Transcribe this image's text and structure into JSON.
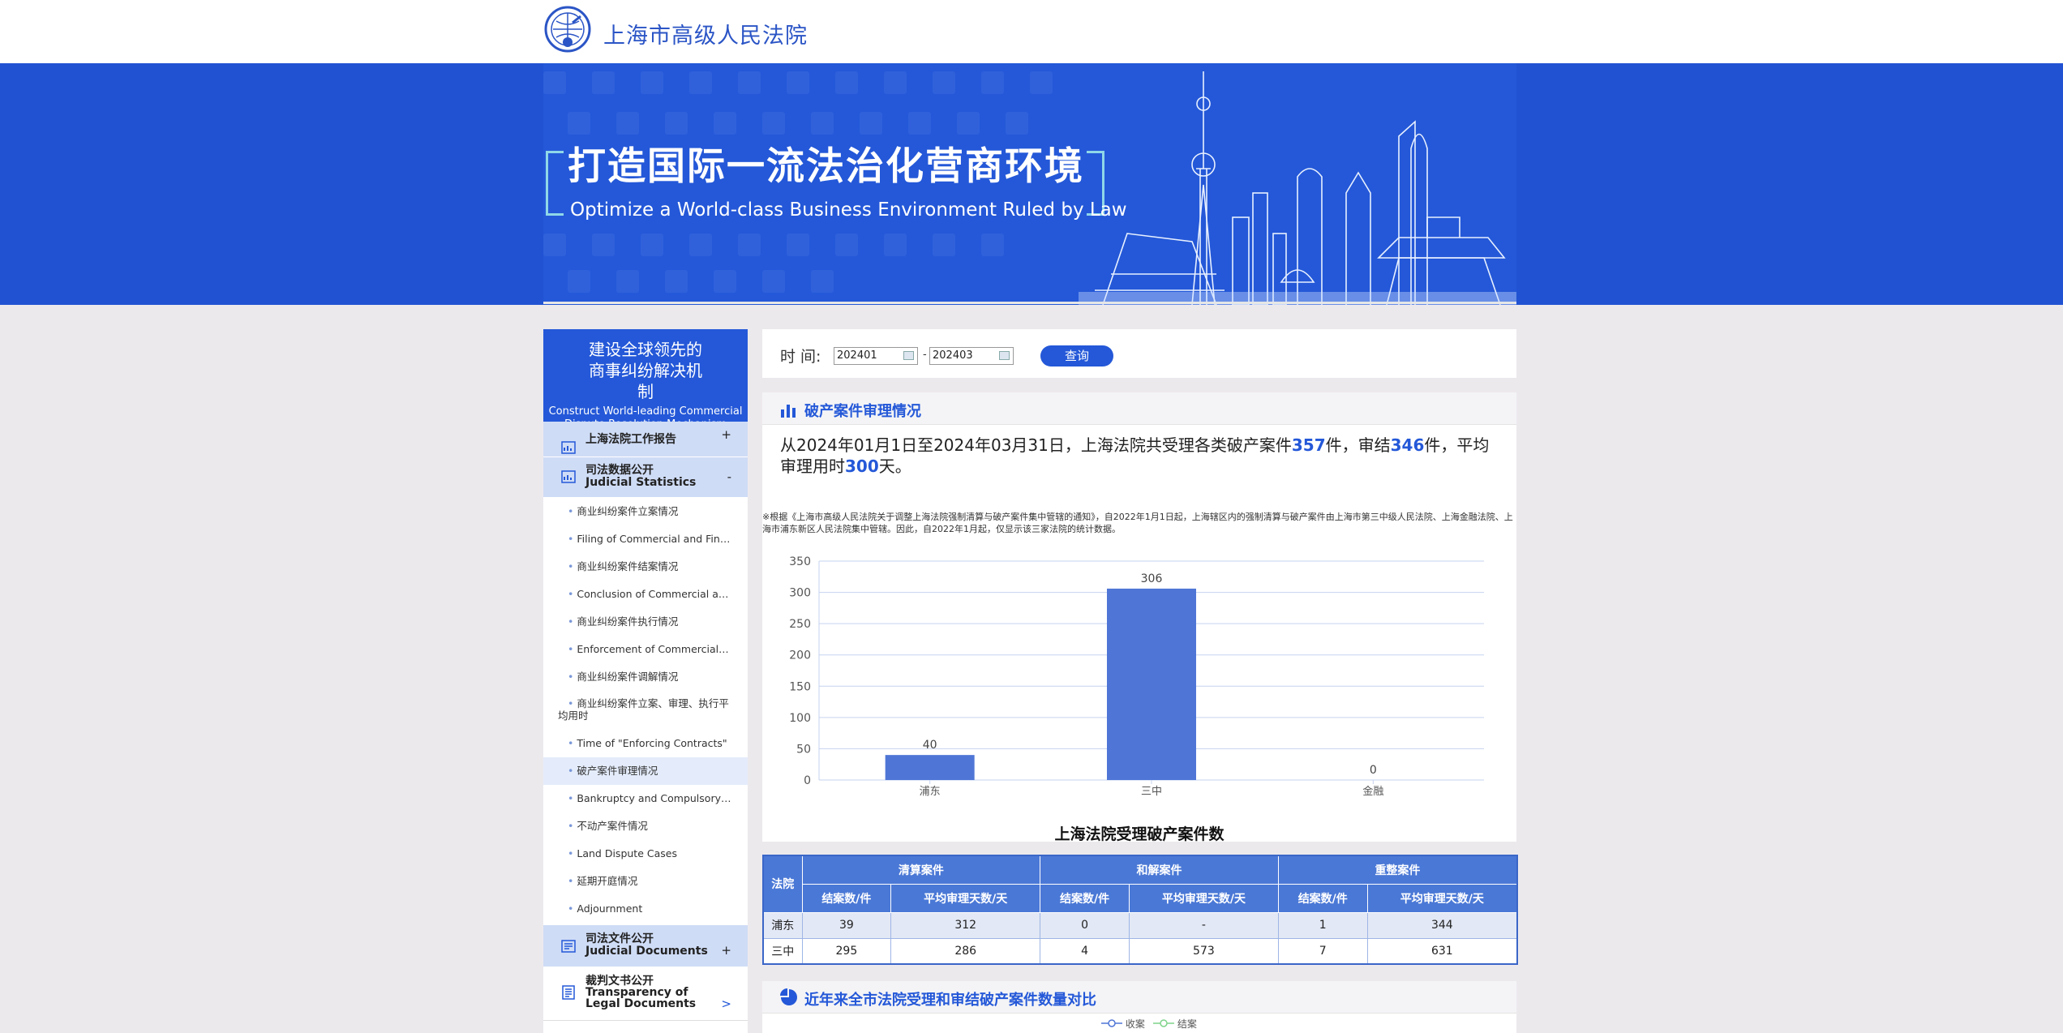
{
  "header": {
    "court_name": "上海市高级人民法院"
  },
  "banner": {
    "title_cn": "打造国际一流法治化营商环境",
    "title_en": "Optimize a World-class Business Environment Ruled by Law"
  },
  "sidebar": {
    "heading_cn": "建设全球领先的商事纠纷解决机制",
    "heading_en": "Construct World-leading Commercial Dispute Resolution Mechanism",
    "sections": [
      {
        "label": "上海法院工作报告",
        "toggle": "+"
      },
      {
        "label_cn": "司法数据公开",
        "label_en": "Judicial Statistics",
        "toggle": "-"
      },
      {
        "label_cn": "司法文件公开",
        "label_en": "Judicial Documents",
        "toggle": "+"
      },
      {
        "label_cn": "裁判文书公开",
        "label_en": "Transparency of Legal Documents",
        "toggle": ">"
      }
    ],
    "items": [
      "商业纠纷案件立案情况",
      "Filing of Commercial and Finan..",
      "商业纠纷案件结案情况",
      "Conclusion of Commercial and..",
      "商业纠纷案件执行情况",
      "Enforcement of Commercial an..",
      "商业纠纷案件调解情况",
      "商业纠纷案件立案、审理、执行平均用时",
      "Time of \"Enforcing Contracts\"",
      "破产案件审理情况",
      "Bankruptcy and Compulsory L..",
      "不动产案件情况",
      "Land Dispute Cases",
      "延期开庭情况",
      "Adjournment"
    ]
  },
  "query": {
    "label": "时 间:",
    "start": "202401",
    "end": "202403",
    "separator": "-",
    "button": "查询"
  },
  "bankruptcy": {
    "section_title": "破产案件审理情况",
    "summary_pre": "从2024年01月1日至2024年03月31日，上海法院共受理各类破产案件",
    "accepted": "357",
    "summary_mid1": "件，审结",
    "concluded": "346",
    "summary_mid2": "件，平均审理用时",
    "avg_days": "300",
    "summary_post": "天。",
    "note": "※根据《上海市高级人民法院关于调整上海法院强制清算与破产案件集中管辖的通知》，自2022年1月1日起，上海辖区内的强制清算与破产案件由上海市第三中级人民法院、上海金融法院、上海市浦东新区人民法院集中管辖。因此，自2022年1月起，仅显示该三家法院的统计数据。"
  },
  "chart_data": {
    "type": "bar",
    "title": "上海法院受理破产案件数",
    "categories": [
      "浦东",
      "三中",
      "金融"
    ],
    "values": [
      40,
      306,
      0
    ],
    "ylim": [
      0,
      350
    ],
    "yticks": [
      0,
      50,
      100,
      150,
      200,
      250,
      300,
      350
    ],
    "grid": true,
    "color": "#4f76d6"
  },
  "table": {
    "court_header": "法院",
    "groups": [
      "清算案件",
      "和解案件",
      "重整案件"
    ],
    "sub_headers": [
      "结案数/件",
      "平均审理天数/天",
      "结案数/件",
      "平均审理天数/天",
      "结案数/件",
      "平均审理天数/天"
    ],
    "rows": [
      {
        "court": "浦东",
        "values": [
          "39",
          "312",
          "0",
          "-",
          "1",
          "344"
        ]
      },
      {
        "court": "三中",
        "values": [
          "295",
          "286",
          "4",
          "573",
          "7",
          "631"
        ]
      }
    ]
  },
  "comparison": {
    "section_title": "近年来全市法院受理和审结破产案件数量对比",
    "legend": [
      "收案",
      "结案"
    ],
    "colors": [
      "#4f76d6",
      "#7ed48a"
    ]
  }
}
